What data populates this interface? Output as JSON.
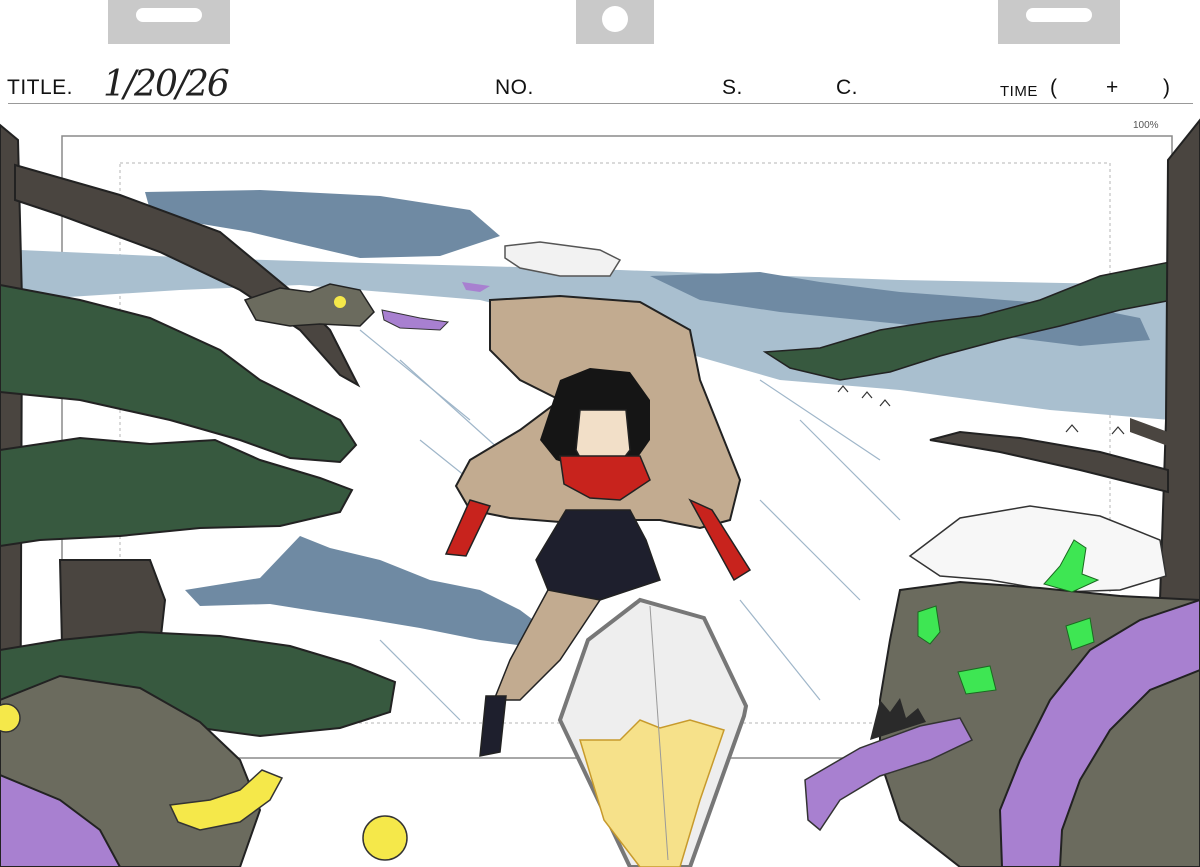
{
  "sheet": {
    "title_label": "TITLE.",
    "title_value": "1/20/26",
    "no_label": "NO.",
    "s_label": "S.",
    "c_label": "C.",
    "time_label": "TIME",
    "time_open": "(",
    "time_plus": "+",
    "time_close": ")",
    "frame_percent": "100%"
  },
  "colors": {
    "snow": "#ffffff",
    "ice": "#a9bfcf",
    "ice_dark": "#6f8aa3",
    "pine": "#37593f",
    "trunk": "#4a4540",
    "rock": "#6b6b5e",
    "cloak": "#c2ab90",
    "scarf": "#c8231d",
    "hair": "#151515",
    "tentacle": "#a880d0",
    "slime_green": "#3ee653",
    "slime_yellow": "#f5e84a",
    "crystal": "#f6e18a"
  }
}
